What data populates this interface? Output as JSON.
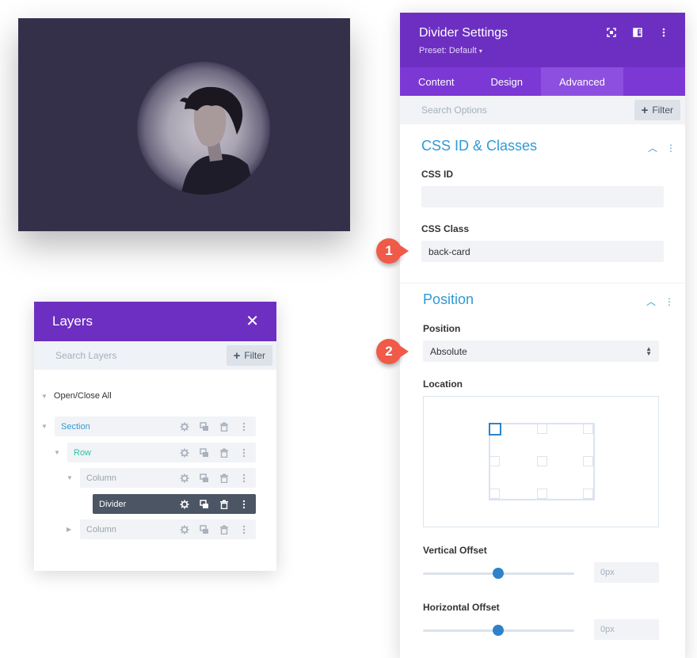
{
  "preview": {
    "image": "portrait-of-young-man-in-circle"
  },
  "layers": {
    "title": "Layers",
    "close_icon": "close-icon",
    "search_placeholder": "Search Layers",
    "filter_label": "Filter",
    "open_close_all": "Open/Close All",
    "items": [
      {
        "label": "Section",
        "color": "#2e9ad6"
      },
      {
        "label": "Row",
        "color": "#29c4a9"
      },
      {
        "label": "Column",
        "color": "#9aa4b0"
      },
      {
        "label": "Divider",
        "color": "#ffffff"
      },
      {
        "label": "Column",
        "color": "#9aa4b0"
      }
    ],
    "row_tools": [
      "gear-icon",
      "duplicate-icon",
      "trash-icon",
      "more-icon"
    ]
  },
  "settings": {
    "title": "Divider Settings",
    "preset": "Preset: Default",
    "header_icons": [
      "fullscreen-icon",
      "columns-icon",
      "more-icon"
    ],
    "tabs": [
      "Content",
      "Design",
      "Advanced"
    ],
    "active_tab": "Advanced",
    "search_placeholder": "Search Options",
    "filter_label": "Filter",
    "css_section": {
      "title": "CSS ID & Classes",
      "css_id_label": "CSS ID",
      "css_id_value": "",
      "css_class_label": "CSS Class",
      "css_class_value": "back-card"
    },
    "position_section": {
      "title": "Position",
      "position_label": "Position",
      "position_value": "Absolute",
      "location_label": "Location",
      "location_selected": "top-left",
      "vertical_offset_label": "Vertical Offset",
      "vertical_offset_value": "0px",
      "horizontal_offset_label": "Horizontal Offset",
      "horizontal_offset_value": "0px"
    }
  },
  "markers": [
    "1",
    "2"
  ],
  "colors": {
    "brand_purple": "#6d2fc1",
    "tab_purple": "#7c38d4",
    "accent_blue": "#2e9ad6",
    "marker_red": "#f05a48"
  }
}
